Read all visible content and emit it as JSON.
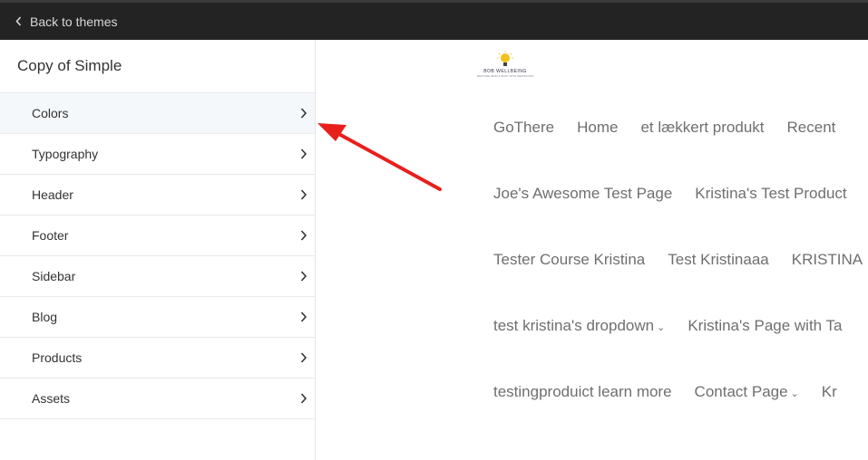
{
  "topbar": {
    "back_label": "Back to themes"
  },
  "sidebar": {
    "title": "Copy of Simple",
    "items": [
      {
        "label": "Colors"
      },
      {
        "label": "Typography"
      },
      {
        "label": "Header"
      },
      {
        "label": "Footer"
      },
      {
        "label": "Sidebar"
      },
      {
        "label": "Blog"
      },
      {
        "label": "Products"
      },
      {
        "label": "Assets"
      }
    ]
  },
  "preview": {
    "logo_text": "BOB WELLBEING",
    "logo_subtext": "RESTORE MIND & BODY WITH MEDITATION",
    "nav_rows": [
      [
        "GoThere",
        "Home",
        "et lækkert produkt",
        "Recent"
      ],
      [
        "Joe's Awesome Test Page",
        "Kristina's Test Product"
      ],
      [
        "Tester Course Kristina",
        "Test Kristinaaa",
        "KRISTINA"
      ],
      [
        "test kristina's dropdown",
        "Kristina's Page with Ta"
      ],
      [
        "testingproduict learn more",
        "Contact Page",
        "Kr"
      ]
    ]
  },
  "colors": {
    "topbar_bg": "#232323",
    "annotation_arrow": "#e8201c",
    "nav_text": "#6f6f6f"
  }
}
